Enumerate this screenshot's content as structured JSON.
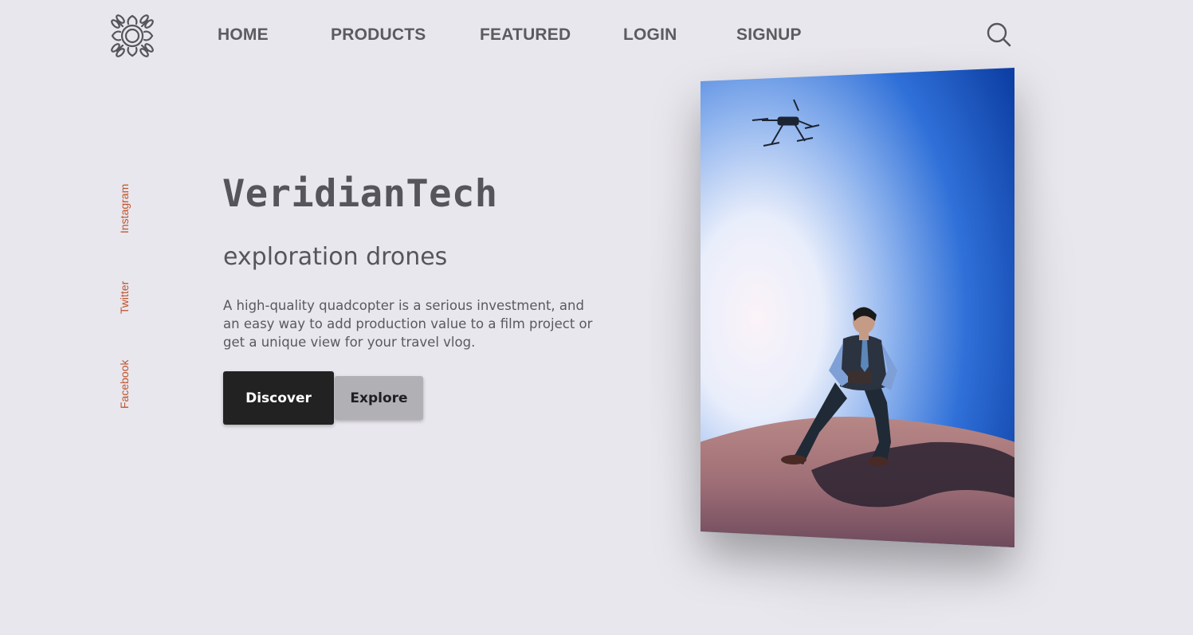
{
  "header": {
    "logo_icon": "drone-logo-icon",
    "nav": {
      "home": "HOME",
      "products": "PRODUCTS",
      "featured": "FEATURED",
      "login": "LOGIN",
      "signup": "SIGNUP"
    },
    "search_icon": "search-icon"
  },
  "social": {
    "instagram": "Instagram",
    "twitter": "Twitter",
    "facebook": "Facebook"
  },
  "hero": {
    "brand": "VeridianTech",
    "subtitle": "exploration drones",
    "description": "A high-quality quadcopter is a serious investment, and an easy way to add production value to a film project or get a unique view for your travel vlog.",
    "discover_label": "Discover",
    "explore_label": "Explore"
  },
  "photo": {
    "subject": "man in desert watching drone"
  },
  "colors": {
    "background": "#e8e7ed",
    "nav_text": "#5b5b60",
    "social_accent": "#c0532f",
    "discover_bg": "#222222",
    "explore_bg": "#b1b0b5"
  }
}
